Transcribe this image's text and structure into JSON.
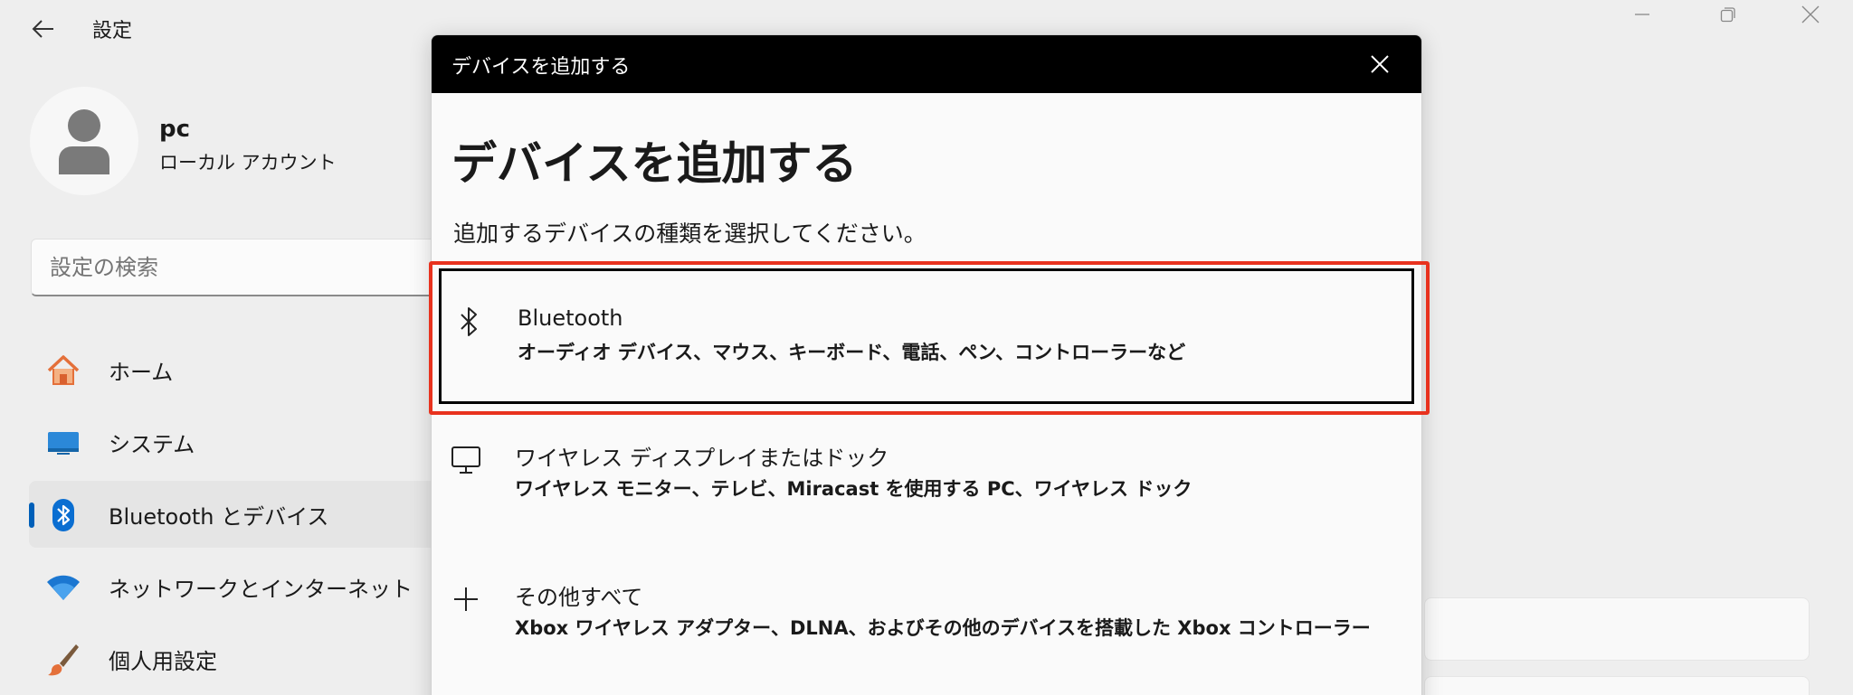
{
  "window": {
    "title": "設定",
    "controls": {
      "minimize": "minimize-icon",
      "maximize": "restore-icon",
      "close": "close-icon"
    }
  },
  "profile": {
    "name": "pc",
    "account_type": "ローカル アカウント"
  },
  "search": {
    "placeholder": "設定の検索"
  },
  "sidebar": {
    "items": [
      {
        "label": "ホーム",
        "icon": "home-icon"
      },
      {
        "label": "システム",
        "icon": "system-icon"
      },
      {
        "label": "Bluetooth とデバイス",
        "icon": "bluetooth-icon",
        "active": true
      },
      {
        "label": "ネットワークとインターネット",
        "icon": "wifi-icon"
      },
      {
        "label": "個人用設定",
        "icon": "brush-icon"
      }
    ]
  },
  "dialog": {
    "titlebar": "デバイスを追加する",
    "heading": "デバイスを追加する",
    "subtitle": "追加するデバイスの種類を選択してください。",
    "options": [
      {
        "title": "Bluetooth",
        "description": "オーディオ デバイス、マウス、キーボード、電話、ペン、コントローラーなど",
        "icon": "bluetooth-icon",
        "selected": true
      },
      {
        "title": "ワイヤレス ディスプレイまたはドック",
        "description": "ワイヤレス モニター、テレビ、Miracast を使用する PC、ワイヤレス ドック",
        "icon": "monitor-icon"
      },
      {
        "title": "その他すべて",
        "description": "Xbox ワイヤレス アダプター、DLNA、およびその他のデバイスを搭載した Xbox コントローラー",
        "icon": "plus-icon"
      }
    ]
  },
  "colors": {
    "accent": "#005fb8",
    "highlight": "#e8321e",
    "dialog_titlebar": "#000000"
  }
}
